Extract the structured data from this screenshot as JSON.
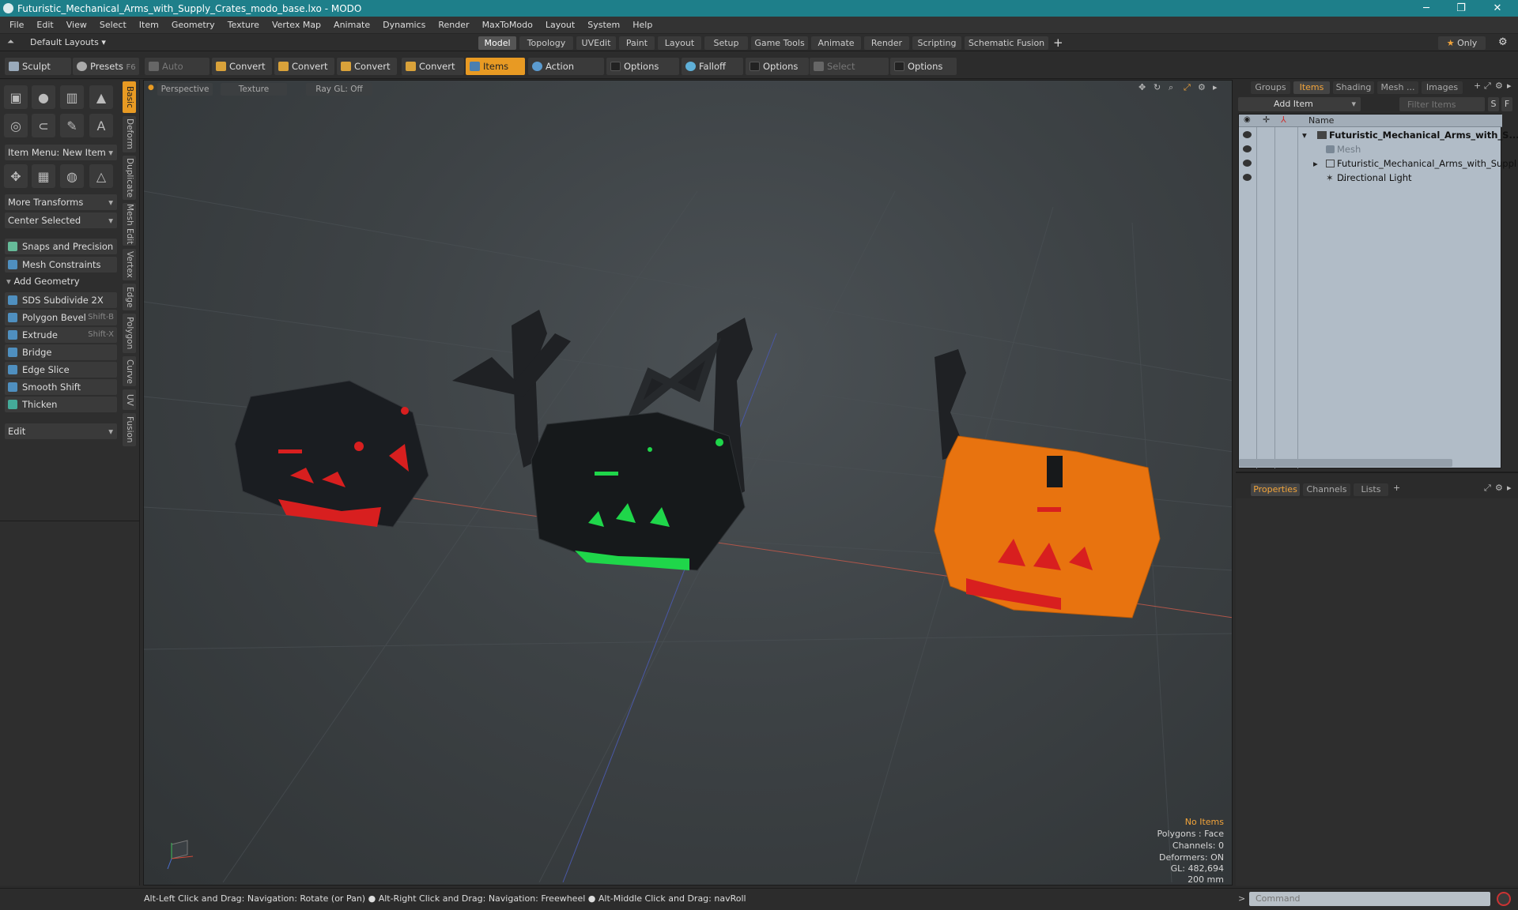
{
  "window": {
    "title": "Futuristic_Mechanical_Arms_with_Supply_Crates_modo_base.lxo - MODO"
  },
  "menu": [
    "File",
    "Edit",
    "View",
    "Select",
    "Item",
    "Geometry",
    "Texture",
    "Vertex Map",
    "Animate",
    "Dynamics",
    "Render",
    "MaxToModo",
    "Layout",
    "System",
    "Help"
  ],
  "layout": {
    "preset": "Default Layouts",
    "tabs": [
      "Model",
      "Topology",
      "UVEdit",
      "Paint",
      "Layout",
      "Setup",
      "Game Tools",
      "Animate",
      "Render",
      "Scripting",
      "Schematic Fusion"
    ],
    "active_tab": "Model",
    "only_label": "Only"
  },
  "toolbar": {
    "sculpt": "Sculpt",
    "presets": "Presets",
    "presets_key": "F6",
    "auto_select": "Auto Select",
    "convert1": "Convert",
    "convert2": "Convert",
    "convert3": "Convert",
    "convert4": "Convert",
    "items": "Items",
    "action_center": "Action Center",
    "options1": "Options",
    "falloff": "Falloff",
    "options2": "Options",
    "select_through": "Select Through",
    "options3": "Options"
  },
  "left": {
    "item_menu": "Item Menu: New Item",
    "more_transforms": "More Transforms",
    "center_selected": "Center Selected",
    "snaps": "Snaps and Precision",
    "mesh_constraints": "Mesh Constraints",
    "add_geometry": "Add Geometry",
    "tools": [
      {
        "label": "SDS Subdivide 2X",
        "key": ""
      },
      {
        "label": "Polygon Bevel",
        "key": "Shift-B"
      },
      {
        "label": "Extrude",
        "key": "Shift-X"
      },
      {
        "label": "Bridge",
        "key": ""
      },
      {
        "label": "Edge Slice",
        "key": ""
      },
      {
        "label": "Smooth Shift",
        "key": ""
      },
      {
        "label": "Thicken",
        "key": ""
      }
    ],
    "edit": "Edit",
    "vtabs": [
      "Basic",
      "Deform",
      "Duplicate",
      "Mesh Edit",
      "Vertex",
      "Edge",
      "Polygon",
      "Curve",
      "UV",
      "Fusion"
    ]
  },
  "viewport": {
    "view": "Perspective",
    "shading": "Texture",
    "raygl": "Ray GL: Off",
    "info": {
      "no_items": "No Items",
      "polygons": "Polygons : Face",
      "channels": "Channels: 0",
      "deformers": "Deformers: ON",
      "gl": "GL: 482,694",
      "scale": "200 mm"
    },
    "colors": {
      "accent": "#e89a23",
      "crate_orange": "#e8730f",
      "crate_red": "#d81f1f",
      "crate_green": "#1fd64a"
    }
  },
  "right": {
    "tabs": [
      "Groups",
      "Items",
      "Shading",
      "Mesh ...",
      "Images"
    ],
    "active_tab": "Items",
    "add_item": "Add Item",
    "filter": "Filter Items",
    "s_btn": "S",
    "f_btn": "F",
    "col_name": "Name",
    "tree": [
      {
        "label": "Futuristic_Mechanical_Arms_with_S...",
        "bold": true
      },
      {
        "label": "Mesh",
        "dim": true
      },
      {
        "label": "Futuristic_Mechanical_Arms_with_Suppl ..."
      },
      {
        "label": "Directional Light"
      }
    ],
    "bottom_tabs": [
      "Properties",
      "Channels",
      "Lists"
    ]
  },
  "status": {
    "hint": "Alt-Left Click and Drag: Navigation: Rotate (or Pan) ● Alt-Right Click and Drag: Navigation: Freewheel ● Alt-Middle Click and Drag: navRoll",
    "command_placeholder": "Command"
  }
}
